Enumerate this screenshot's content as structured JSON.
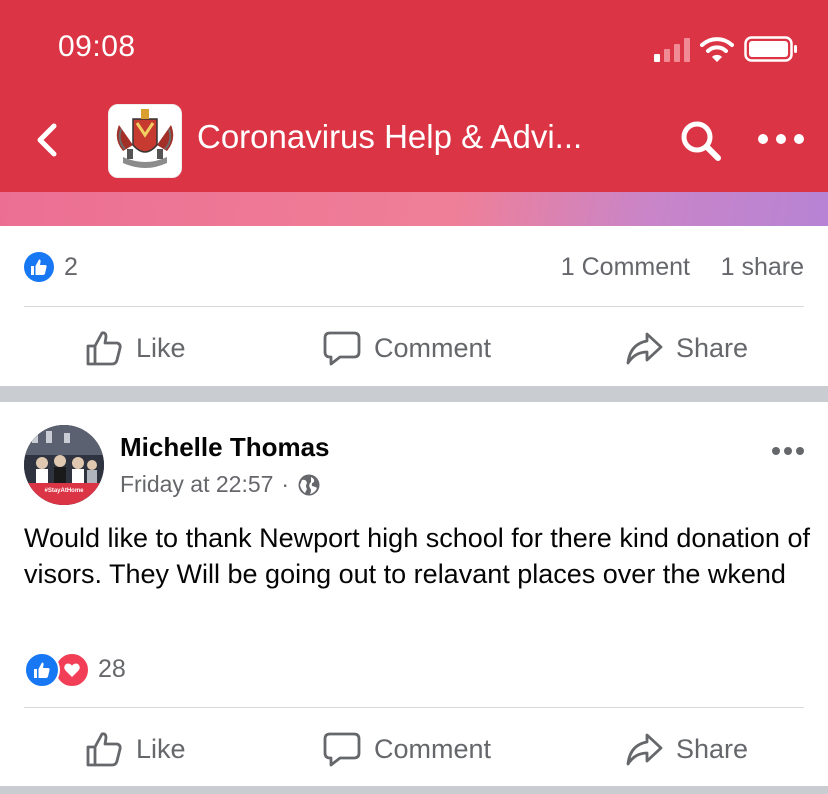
{
  "status_bar": {
    "time": "09:08"
  },
  "header": {
    "group_title": "Coronavirus Help & Advi..."
  },
  "post1": {
    "like_count": "2",
    "comments": "1 Comment",
    "shares": "1 share",
    "actions": {
      "like": "Like",
      "comment": "Comment",
      "share": "Share"
    }
  },
  "post2": {
    "author": "Michelle Thomas",
    "time": "Friday at 22:57",
    "separator": "·",
    "avatar_banner": "#StayAtHome",
    "text": "Would like to thank  Newport high school for there kind donation of visors.  They Will be going out to relavant places over the wkend",
    "reaction_count": "28",
    "actions": {
      "like": "Like",
      "comment": "Comment",
      "share": "Share"
    }
  },
  "colors": {
    "header": "#db3444",
    "facebook_blue": "#1877f2",
    "love_red": "#f33e58",
    "muted_text": "#65676b"
  }
}
